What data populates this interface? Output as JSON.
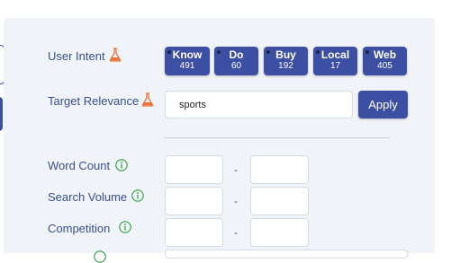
{
  "filters": {
    "user_intent": {
      "label": "User Intent",
      "icon": "flask-icon",
      "buttons": [
        {
          "name": "Know",
          "count": "491"
        },
        {
          "name": "Do",
          "count": "60"
        },
        {
          "name": "Buy",
          "count": "192"
        },
        {
          "name": "Local",
          "count": "17"
        },
        {
          "name": "Web",
          "count": "405"
        }
      ]
    },
    "target_relevance": {
      "label": "Target Relevance",
      "icon": "flask-icon",
      "value": "sports",
      "apply_label": "Apply"
    },
    "word_count": {
      "label": "Word Count",
      "icon": "info-icon",
      "separator": "-"
    },
    "search_volume": {
      "label": "Search Volume",
      "icon": "info-icon",
      "separator": "-"
    },
    "competition": {
      "label": "Competition",
      "icon": "info-icon",
      "separator": "-"
    }
  },
  "colors": {
    "accent": "#3c4fa3",
    "label_text": "#3a4f8c",
    "flask": "#e8743b",
    "info": "#2e9e3e",
    "panel_bg": "#f0f3f7"
  }
}
